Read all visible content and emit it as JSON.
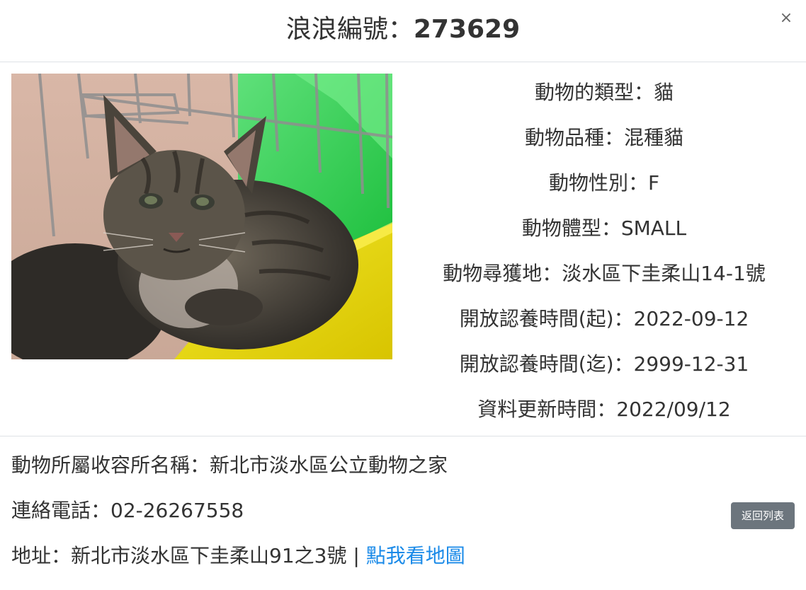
{
  "header": {
    "title_label": "浪浪編號：",
    "title_id": "273629",
    "close_symbol": "×"
  },
  "photo": {
    "icon": "cat-photo"
  },
  "details": [
    {
      "label": "動物的類型",
      "value": "貓",
      "text": "動物的類型：貓"
    },
    {
      "label": "動物品種",
      "value": "混種貓",
      "text": "動物品種：混種貓"
    },
    {
      "label": "動物性別",
      "value": "F",
      "text": "動物性別：F"
    },
    {
      "label": "動物體型",
      "value": "SMALL",
      "text": "動物體型：SMALL"
    },
    {
      "label": "動物尋獲地",
      "value": "淡水區下圭柔山14-1號",
      "text": "動物尋獲地：淡水區下圭柔山14-1號"
    },
    {
      "label": "開放認養時間(起)",
      "value": "2022-09-12",
      "text": "開放認養時間(起)：2022-09-12"
    },
    {
      "label": "開放認養時間(迄)",
      "value": "2999-12-31",
      "text": "開放認養時間(迄)：2999-12-31"
    },
    {
      "label": "資料更新時間",
      "value": "2022/09/12",
      "text": "資料更新時間：2022/09/12"
    }
  ],
  "shelter": {
    "name_text": "動物所屬收容所名稱：新北市淡水區公立動物之家",
    "phone_text": "連絡電話：02-26267558",
    "address_text": "地址：新北市淡水區下圭柔山91之3號 | ",
    "map_link_label": "點我看地圖"
  },
  "footer": {
    "back_button_label": "返回列表"
  },
  "colors": {
    "link": "#1a8ae8",
    "button_bg": "#6c757d",
    "divider": "#dee2e6"
  }
}
